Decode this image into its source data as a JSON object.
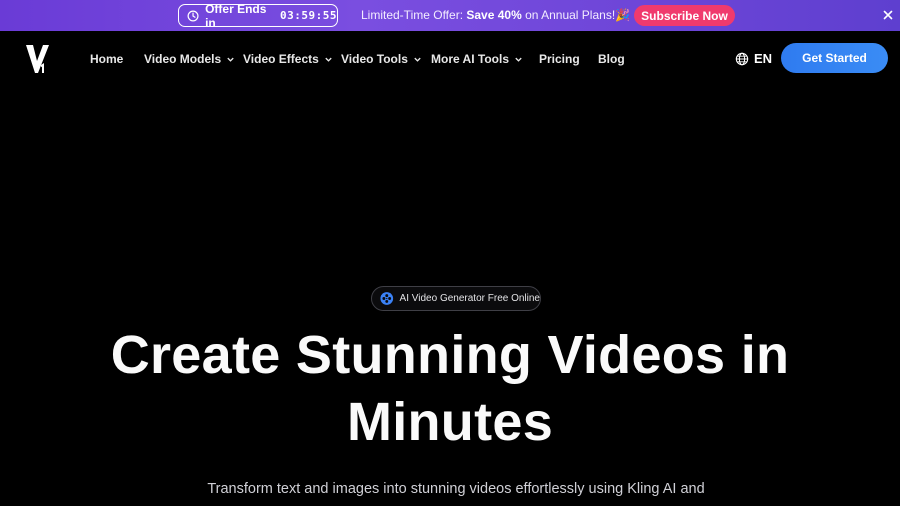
{
  "promo": {
    "offer_label": "Offer Ends in",
    "countdown": "03:59:55",
    "text_prefix": "Limited-Time Offer: ",
    "text_bold": "Save 40%",
    "text_suffix": " on Annual Plans!🎉",
    "subscribe_label": "Subscribe Now",
    "close_icon": "close-icon",
    "colors": {
      "banner": "#6a3bd6",
      "subscribe": "#f03a6d"
    }
  },
  "nav": {
    "logo_icon": "v1-logo",
    "items": [
      {
        "label": "Home",
        "dropdown": false
      },
      {
        "label": "Video Models",
        "dropdown": true
      },
      {
        "label": "Video Effects",
        "dropdown": true
      },
      {
        "label": "Video Tools",
        "dropdown": true
      },
      {
        "label": "More AI Tools",
        "dropdown": true
      },
      {
        "label": "Pricing",
        "dropdown": false
      },
      {
        "label": "Blog",
        "dropdown": false
      }
    ],
    "language": "EN",
    "cta_label": "Get Started",
    "colors": {
      "cta": "#2f7bf0"
    }
  },
  "hero": {
    "badge": "AI Video Generator Free Online",
    "title_line1": "Create Stunning Videos in",
    "title_line2": "Minutes",
    "subtitle": "Transform text and images into stunning videos effortlessly using Kling AI and"
  }
}
